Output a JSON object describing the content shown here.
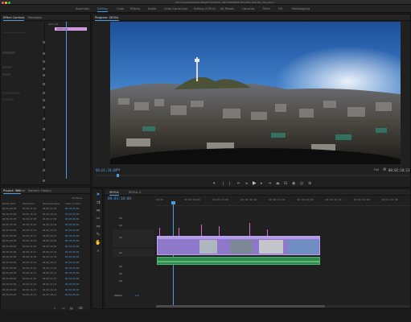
{
  "window": {
    "title": "/Volumes/Media/360 PROJECTS/SEOUL 360 PREMIERE PRO/360_DIGITAL_VR.prproj *"
  },
  "workspaces": [
    "Assembly",
    "Editing",
    "Color",
    "Effects",
    "Audio",
    "Color Correction",
    "Editing (CS5.5)",
    "All Panels",
    "Libraries",
    "Titles",
    "VR",
    "Metalogging"
  ],
  "active_workspace": "Editing",
  "effect_controls": {
    "tabs": [
      "Effect Controls",
      "Metadata"
    ],
    "timecode": "00;01;06",
    "clip_label": "1099.mp4"
  },
  "program_monitor": {
    "tab": "Program: SEOUL",
    "timecode": "00;01;10;08",
    "zoom": "Fit",
    "quality": "Full",
    "duration": "00;02;10;12"
  },
  "project": {
    "tabs": [
      "Project: 360",
      "Effects",
      "Markers",
      "History"
    ],
    "item_count": "18 items",
    "columns": [
      "Media Start",
      "Media End",
      "Media Duration",
      "Video In Point"
    ],
    "rows": [
      [
        "00;00;00;00",
        "00;00;41;03",
        "00;00;41;04",
        "00;00;00;00"
      ],
      [
        "00;00;00;00",
        "00;00;18;23",
        "00;00;18;24",
        "00;00;00;00"
      ],
      [
        "00;00;00;00",
        "00;00;27;08",
        "00;00;27;09",
        "00;00;00;00"
      ],
      [
        "00;00;00;00",
        "00;00;14;03",
        "00;00;14;04",
        "00;00;00;00"
      ],
      [
        "00;00;00;00",
        "00;00;33;15",
        "00;00;33;16",
        "00;00;00;00"
      ],
      [
        "00;00;00;00",
        "00;00;22;11",
        "00;00;22;12",
        "00;00;00;00"
      ],
      [
        "00;00;00;00",
        "00;00;19;29",
        "00;00;20;00",
        "00;00;00;00"
      ],
      [
        "00;00;00;00",
        "00;00;36;05",
        "00;00;36;06",
        "00;00;00;00"
      ],
      [
        "00;00;00;00",
        "00;00;25;17",
        "00;00;25;18",
        "00;00;00;00"
      ],
      [
        "00;00;00;00",
        "00;00;12;09",
        "00;00;12;10",
        "00;00;00;00"
      ],
      [
        "00;00;00;00",
        "00;00;29;22",
        "00;00;29;23",
        "00;00;00;00"
      ],
      [
        "00;00;00;00",
        "00;00;17;01",
        "00;00;17;02",
        "00;00;00;00"
      ],
      [
        "00;00;00;00",
        "00;00;44;13",
        "00;00;44;14",
        "00;00;00;00"
      ],
      [
        "00;00;00;00",
        "00;00;21;06",
        "00;00;21;07",
        "00;00;00;00"
      ],
      [
        "00;00;00;00",
        "00;00;31;18",
        "00;00;31;19",
        "00;00;00;00"
      ],
      [
        "00;00;00;00",
        "00;00;16;27",
        "00;00;16;28",
        "00;00;00;00"
      ],
      [
        "00;00;00;00",
        "00;00;38;10",
        "00;00;38;11",
        "00;00;00;00"
      ]
    ]
  },
  "timeline": {
    "tabs": [
      "SEOUL",
      "SEOUL 2"
    ],
    "timecode": "00;01;10;08",
    "ruler": [
      "00;00",
      "00;00;08;00",
      "00;00;16;00",
      "00;00;24;00",
      "00;00;32;00",
      "00;00;40;00",
      "00;00;48;00",
      "00;00;56;00",
      "00;01;04;00"
    ],
    "video_tracks": [
      "V3",
      "V2",
      "V1"
    ],
    "audio_tracks": [
      "A1",
      "A2",
      "A3",
      "A4"
    ],
    "master_label": "Master",
    "master_value": "0.0"
  },
  "colors": {
    "accent": "#4f9be0",
    "video_clip": "#8d78c9",
    "audio_clip": "#2c8a4b",
    "marker": "#d76ad2"
  }
}
